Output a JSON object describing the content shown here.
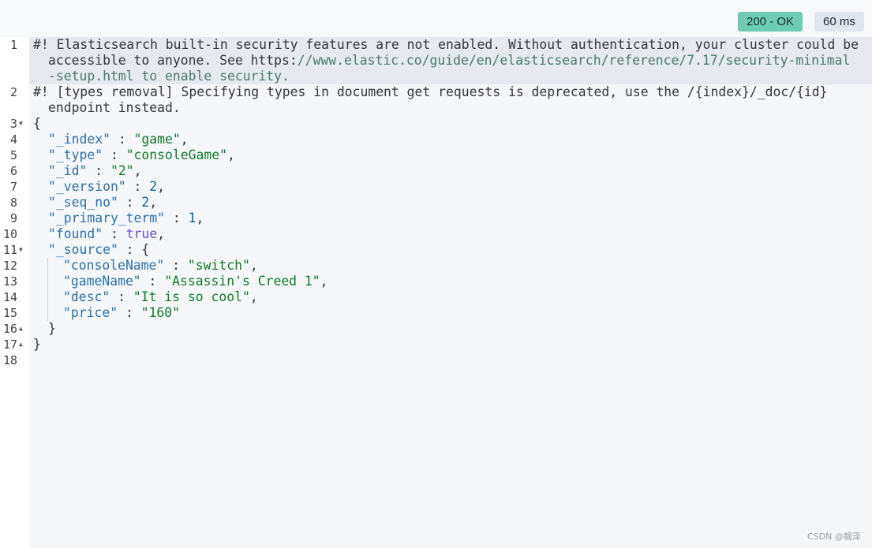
{
  "header": {
    "status": "200 - OK",
    "time": "60 ms"
  },
  "editor": {
    "line_numbers": [
      "1",
      "2",
      "3",
      "4",
      "5",
      "6",
      "7",
      "8",
      "9",
      "10",
      "11",
      "12",
      "13",
      "14",
      "15",
      "16",
      "17",
      "18"
    ],
    "comment1": {
      "line1": "#! Elasticsearch built-in security features are not enabled. Without authentication, your cluster could be",
      "line2_prefix": "accessible to anyone. See https:",
      "line2_url": "//www.elastic.co/guide/en/elasticsearch/reference/7.17/security-minimal",
      "line3_url": "-setup.html to enable security."
    },
    "comment2": {
      "line1": "#! [types removal] Specifying types in document get requests is deprecated, use the /{index}/_doc/{id}",
      "line2": "endpoint instead."
    },
    "json": {
      "open_brace": "{",
      "close_brace": "}",
      "source_close": "}",
      "index_key": "\"_index\"",
      "index_val": "\"game\"",
      "type_key": "\"_type\"",
      "type_val": "\"consoleGame\"",
      "id_key": "\"_id\"",
      "id_val": "\"2\"",
      "version_key": "\"_version\"",
      "version_val": "2",
      "seq_key": "\"_seq_no\"",
      "seq_val": "2",
      "term_key": "\"_primary_term\"",
      "term_val": "1",
      "found_key": "\"found\"",
      "found_val": "true",
      "source_key": "\"_source\"",
      "console_key": "\"consoleName\"",
      "console_val": "\"switch\"",
      "game_key": "\"gameName\"",
      "game_val": "\"Assassin's Creed 1\"",
      "desc_key": "\"desc\"",
      "desc_val": "\"It is so cool\"",
      "price_key": "\"price\"",
      "price_val": "\"160\""
    }
  },
  "watermark": "CSDN @靓泽"
}
